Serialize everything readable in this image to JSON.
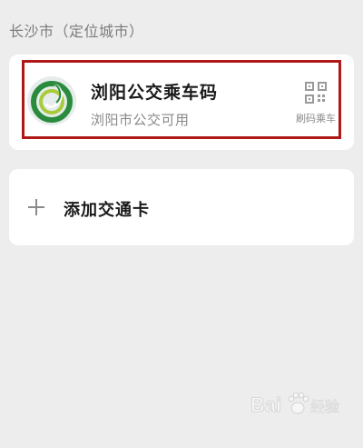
{
  "section": {
    "header": "长沙市（定位城市）"
  },
  "bus_card": {
    "title": "浏阳公交乘车码",
    "subtitle": "浏阳市公交可用",
    "action_label": "刷码乘车",
    "action_icon": "qr-code-icon",
    "logo_icon": "liuyang-bus-logo",
    "highlight_color": "#b01818"
  },
  "add_card": {
    "label": "添加交通卡",
    "icon": "plus-icon"
  },
  "watermark": {
    "text": "Bai 经验",
    "icon": "baidu-paw-icon"
  }
}
